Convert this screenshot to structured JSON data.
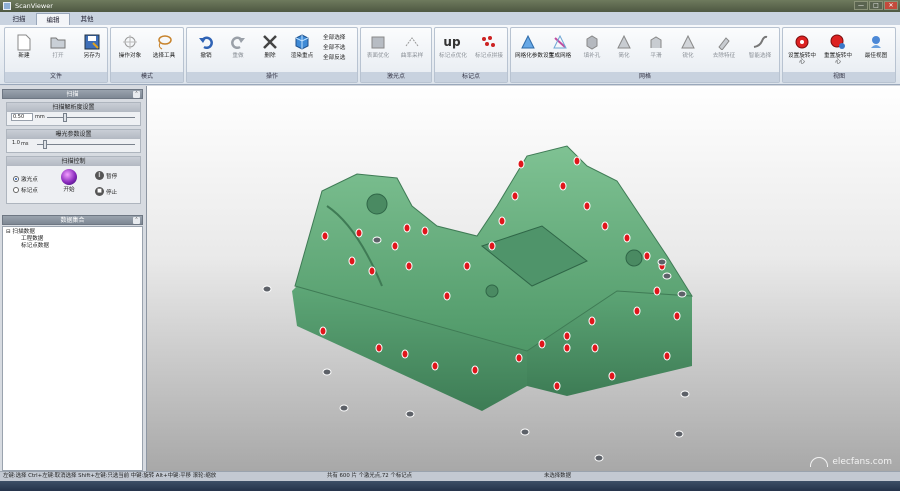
{
  "window": {
    "title": "ScanViewer",
    "controls": [
      "—",
      "□",
      "✕"
    ]
  },
  "tabs": [
    {
      "label": "扫描",
      "active": false
    },
    {
      "label": "编辑",
      "active": true
    },
    {
      "label": "其他",
      "active": false
    }
  ],
  "ribbon": {
    "groups": [
      {
        "caption": "文件",
        "buttons": [
          {
            "label": "新建",
            "icon": "new-file-icon"
          },
          {
            "label": "打开",
            "icon": "open-folder-icon"
          },
          {
            "label": "另存为",
            "icon": "save-as-icon"
          }
        ]
      },
      {
        "caption": "模式",
        "buttons": [
          {
            "label": "操作对象",
            "icon": "operate-object-icon"
          },
          {
            "label": "选择工具",
            "icon": "lasso-select-icon"
          }
        ]
      },
      {
        "caption": "操作",
        "buttons": [
          {
            "label": "撤销",
            "icon": "undo-icon"
          },
          {
            "label": "重做",
            "icon": "redo-icon"
          },
          {
            "label": "删除",
            "icon": "delete-icon"
          },
          {
            "label": "渲染重点",
            "icon": "cube-render-icon"
          }
        ],
        "small": [
          "全部选择",
          "全部不选",
          "全部反选"
        ]
      },
      {
        "caption": "激光点",
        "buttons": [
          {
            "label": "表面优化",
            "icon": "surface-optimize-icon"
          },
          {
            "label": "曲率采样",
            "icon": "curvature-sample-icon"
          }
        ]
      },
      {
        "caption": "标记点",
        "buttons": [
          {
            "label": "标记点优化",
            "icon": "marker-optimize-icon"
          },
          {
            "label": "标记点拼接",
            "icon": "marker-stitch-icon"
          }
        ]
      },
      {
        "caption": "网格",
        "buttons": [
          {
            "label": "网格化参数设置",
            "icon": "mesh-params-icon"
          },
          {
            "label": "生成网格",
            "icon": "generate-mesh-icon"
          },
          {
            "label": "填补孔",
            "icon": "fill-hole-icon"
          },
          {
            "label": "简化",
            "icon": "simplify-icon"
          },
          {
            "label": "平滑",
            "icon": "smooth-icon"
          },
          {
            "label": "锐化",
            "icon": "sharpen-icon"
          },
          {
            "label": "去除特征",
            "icon": "remove-feature-icon"
          },
          {
            "label": "智能选择",
            "icon": "smart-select-icon"
          }
        ]
      },
      {
        "caption": "视图",
        "buttons": [
          {
            "label": "设置旋转中心",
            "icon": "set-rotation-center-icon"
          },
          {
            "label": "重置旋转中心",
            "icon": "reset-rotation-center-icon"
          },
          {
            "label": "最佳视图",
            "icon": "best-view-icon"
          }
        ]
      }
    ]
  },
  "left_panel": {
    "scan_header": "扫描",
    "exposure_title": "扫描解析度设置",
    "exposure_value": "0.50",
    "exposure_unit": "mm",
    "exposure2_title": "曝光参数设置",
    "exposure2_value": "1.0",
    "exposure2_unit": "ms",
    "scan_control_title": "扫描控制",
    "radio_laser": "激光点",
    "radio_marker": "标记点",
    "start_label": "开始",
    "pause_label": "暂停",
    "stop_label": "停止",
    "data_header": "数据集合",
    "tree": {
      "root": "扫描数据",
      "child1": "工程数据",
      "child2": "标记点数据"
    }
  },
  "status": {
    "hint": "左键:选择 Ctrl+左键:取消选择 Shift+左键:只选当前 中键:旋转 Alt+中键:平移 滚轮:缩放",
    "count": "共有 600 片 个激光点,72 个标记点",
    "selection": "未选择数据"
  },
  "watermark": "elecfans.com"
}
